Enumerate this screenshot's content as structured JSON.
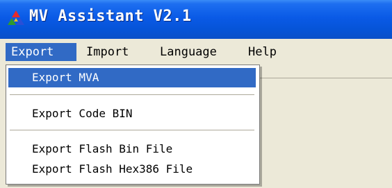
{
  "window": {
    "title": "MV Assistant V2.1"
  },
  "menubar": {
    "items": [
      {
        "label": "Export",
        "active": true
      },
      {
        "label": "Import"
      },
      {
        "label": "Language"
      },
      {
        "label": "Help"
      }
    ]
  },
  "export_menu": {
    "items": [
      {
        "label": "Export MVA",
        "highlighted": true
      },
      {
        "label": "Export Code BIN"
      },
      {
        "label": "Export Flash Bin File"
      },
      {
        "label": "Export Flash Hex386 File"
      }
    ]
  },
  "icons": {
    "app": "app-logo-icon"
  },
  "colors": {
    "title_bar": "#0a5ae6",
    "highlight": "#316ac5",
    "menu_background": "#ece9d8"
  }
}
